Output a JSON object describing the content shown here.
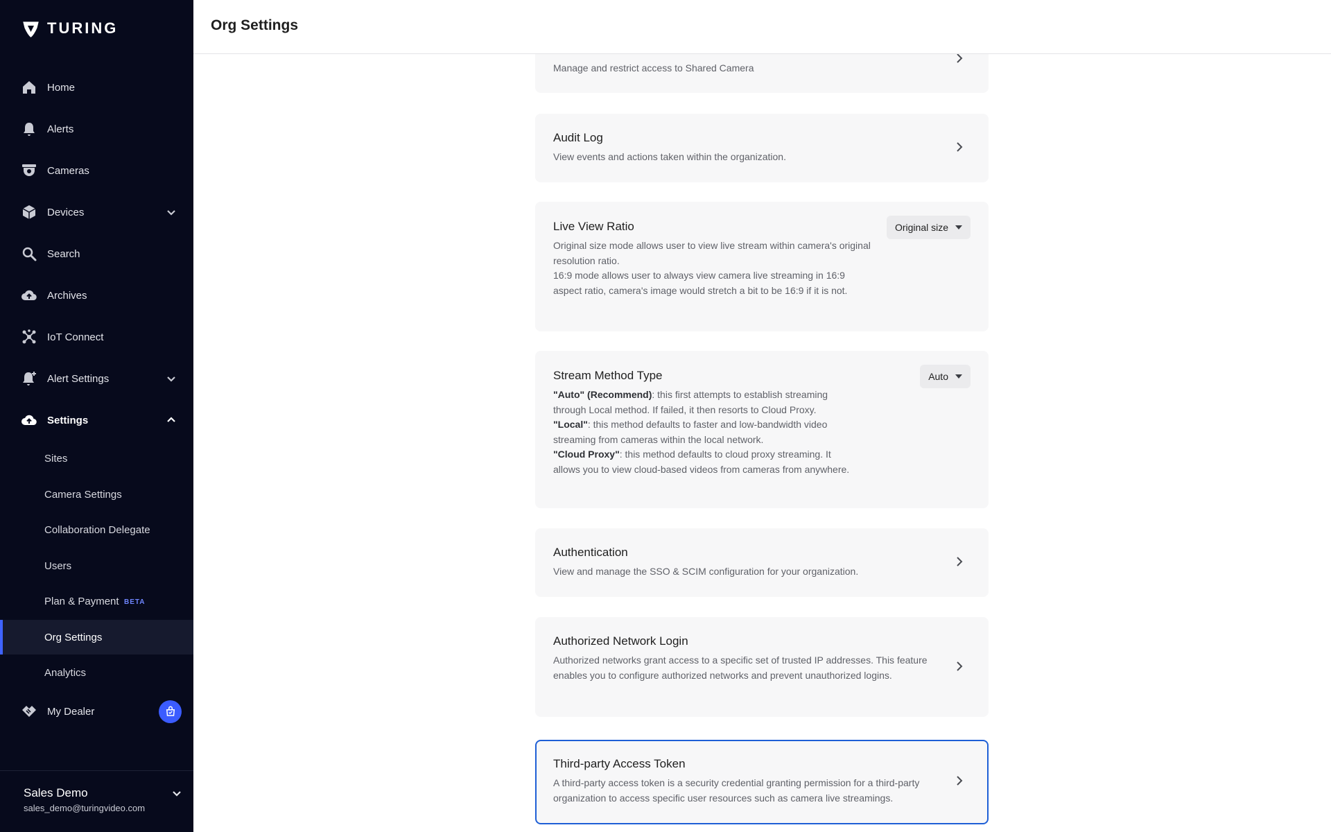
{
  "brand": {
    "name": "TURING"
  },
  "header": {
    "title": "Org Settings"
  },
  "sidebar": {
    "items": [
      {
        "label": "Home",
        "icon": "home-icon"
      },
      {
        "label": "Alerts",
        "icon": "bell-icon"
      },
      {
        "label": "Cameras",
        "icon": "camera-icon"
      },
      {
        "label": "Devices",
        "icon": "box-icon"
      },
      {
        "label": "Search",
        "icon": "search-icon"
      },
      {
        "label": "Archives",
        "icon": "cloud-upload-icon"
      },
      {
        "label": "IoT Connect",
        "icon": "hub-icon"
      },
      {
        "label": "Alert Settings",
        "icon": "bell-plus-icon"
      },
      {
        "label": "Settings",
        "icon": "cloud-gear-icon"
      }
    ],
    "settings_sub": [
      {
        "label": "Sites"
      },
      {
        "label": "Camera Settings"
      },
      {
        "label": "Collaboration Delegate"
      },
      {
        "label": "Users"
      },
      {
        "label": "Plan & Payment",
        "badge": "BETA"
      },
      {
        "label": "Org Settings"
      },
      {
        "label": "Analytics"
      }
    ],
    "dealer": {
      "label": "My Dealer"
    },
    "account": {
      "name": "Sales Demo",
      "email": "sales_demo@turingvideo.com"
    }
  },
  "cards": {
    "shared_camera": {
      "desc": "Manage and restrict access to Shared Camera"
    },
    "audit_log": {
      "title": "Audit Log",
      "desc": "View events and actions taken within the organization."
    },
    "live_view_ratio": {
      "title": "Live View Ratio",
      "desc1": "Original size mode allows user to view live stream within camera's original resolution ratio.",
      "desc2": "16:9 mode allows user to always view camera live streaming in 16:9 aspect ratio, camera's image would stretch a bit to be 16:9 if it is not.",
      "selected": "Original size"
    },
    "stream_method": {
      "title": "Stream Method Type",
      "auto_key": "\"Auto\" (Recommend)",
      "auto_text": ": this first attempts to establish streaming through Local method. If failed, it then resorts to Cloud Proxy.",
      "local_key": "\"Local\"",
      "local_text": ": this method defaults to faster and low-bandwidth video streaming from cameras within the local network.",
      "cloud_key": "\"Cloud Proxy\"",
      "cloud_text": ": this method defaults to cloud proxy streaming. It allows you to view cloud-based videos from cameras from anywhere.",
      "selected": "Auto"
    },
    "authentication": {
      "title": "Authentication",
      "desc": "View and manage the SSO & SCIM configuration for your organization."
    },
    "authorized_network": {
      "title": "Authorized Network Login",
      "desc": "Authorized networks grant access to a specific set of trusted IP addresses. This feature enables you to configure authorized networks and prevent unauthorized logins."
    },
    "third_party": {
      "title": "Third-party Access Token",
      "desc": "A third-party access token is a security credential granting permission for a third-party organization to access specific user resources such as camera live streamings."
    }
  },
  "colors": {
    "sidebar_bg": "#070a1c",
    "accent": "#3f63ff",
    "highlight_border": "#1e5fd6"
  }
}
